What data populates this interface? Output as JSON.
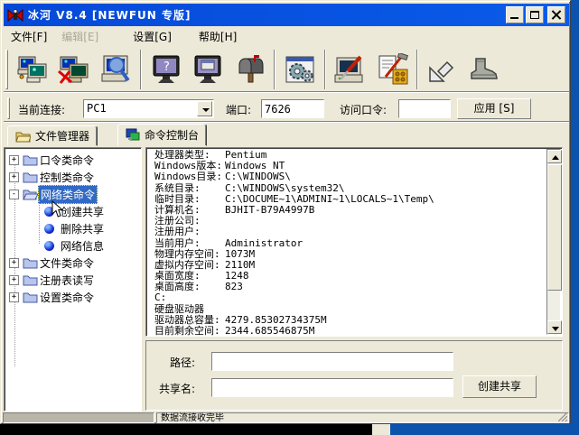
{
  "window": {
    "title": "冰河 V8.4 [NEWFUN 专版]"
  },
  "menu": {
    "items": [
      {
        "label": "文件[F]",
        "enabled": true
      },
      {
        "label": "编辑[E]",
        "enabled": false
      },
      {
        "label": "设置[G]",
        "enabled": true
      },
      {
        "label": "帮助[H]",
        "enabled": true
      }
    ]
  },
  "toolbar": {
    "buttons": [
      {
        "name": "add-connection",
        "icon": "computers-add-icon"
      },
      {
        "name": "delete-connection",
        "icon": "computers-delete-icon"
      },
      {
        "name": "search-computers",
        "icon": "computer-search-icon"
      },
      {
        "name": "screen-viewer",
        "icon": "monitor-question-icon"
      },
      {
        "name": "remote-control",
        "icon": "monitor-window-icon"
      },
      {
        "name": "mail-notify",
        "icon": "mailbox-icon"
      },
      {
        "name": "settings",
        "icon": "gears-window-icon"
      },
      {
        "name": "system-tools",
        "icon": "computer-screwdriver-icon"
      },
      {
        "name": "server-config",
        "icon": "document-hammer-icon"
      },
      {
        "name": "upgrade",
        "icon": "arrow-downleft-icon"
      },
      {
        "name": "kick",
        "icon": "boot-icon"
      }
    ]
  },
  "connection_bar": {
    "current_connection_label": "当前连接:",
    "current_connection_value": "PC1",
    "port_label": "端口:",
    "port_value": "7626",
    "password_label": "访问口令:",
    "password_value": "",
    "apply_button": "应用 [S]"
  },
  "tabs": [
    {
      "label": "文件管理器",
      "icon": "folder-icon",
      "active": false
    },
    {
      "label": "命令控制台",
      "icon": "console-icon",
      "active": true
    }
  ],
  "tree": {
    "items": [
      {
        "label": "口令类命令",
        "toggle": "+"
      },
      {
        "label": "控制类命令",
        "toggle": "+"
      },
      {
        "label": "网络类命令",
        "toggle": "-",
        "selected": true
      },
      {
        "label": "文件类命令",
        "toggle": "+"
      },
      {
        "label": "注册表读写",
        "toggle": "+"
      },
      {
        "label": "设置类命令",
        "toggle": "+"
      }
    ],
    "network_children": [
      {
        "label": "创建共享"
      },
      {
        "label": "删除共享"
      },
      {
        "label": "网络信息"
      }
    ]
  },
  "system_info": {
    "rows": [
      {
        "label": "处理器类型:",
        "value": "Pentium"
      },
      {
        "label": "Windows版本:",
        "value": "Windows NT"
      },
      {
        "label": "Windows目录:",
        "value": "C:\\WINDOWS\\"
      },
      {
        "label": "系统目录:",
        "value": "C:\\WINDOWS\\system32\\"
      },
      {
        "label": "临时目录:",
        "value": "C:\\DOCUME~1\\ADMINI~1\\LOCALS~1\\Temp\\"
      },
      {
        "label": "计算机名:",
        "value": "BJHIT-B79A4997B"
      },
      {
        "label": "注册公司:",
        "value": ""
      },
      {
        "label": "注册用户:",
        "value": ""
      },
      {
        "label": "当前用户:",
        "value": "Administrator"
      },
      {
        "label": "物理内存空间:",
        "value": "1073M"
      },
      {
        "label": "虚拟内存空间:",
        "value": "2110M"
      },
      {
        "label": "桌面宽度:",
        "value": "1248"
      },
      {
        "label": "桌面高度:",
        "value": "823"
      },
      {
        "label": "C:",
        "value": ""
      },
      {
        "label": "硬盘驱动器",
        "value": ""
      },
      {
        "label": "驱动器总容量:",
        "value": "4279.85302734375M"
      },
      {
        "label": "目前剩余空间:",
        "value": "2344.685546875M"
      }
    ]
  },
  "share_form": {
    "path_label": "路径:",
    "path_value": "",
    "share_name_label": "共享名:",
    "share_name_value": "",
    "create_button": "创建共享"
  },
  "status_bar": {
    "message": "数据流接收完毕"
  },
  "colors": {
    "titlebar_blue": "#0855e0",
    "desktop_blue": "#0b53ad",
    "face": "#ece9d8",
    "selection_blue": "#316ac5"
  }
}
